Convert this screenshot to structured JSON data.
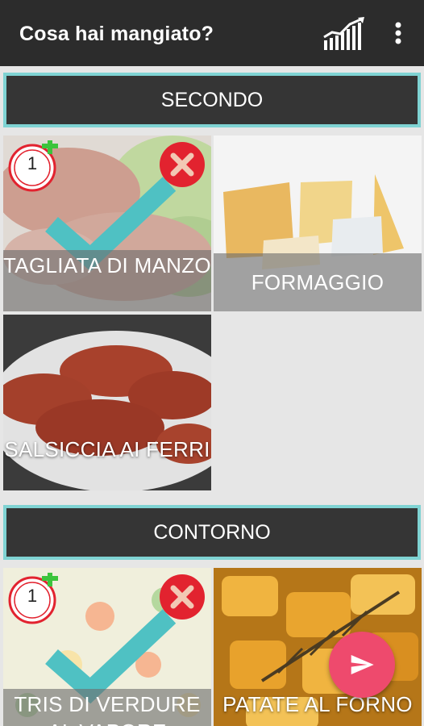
{
  "appbar": {
    "title": "Cosa hai mangiato?",
    "stats_icon": "bar-chart-trend-icon",
    "menu_icon": "more-vert-icon"
  },
  "sections": [
    {
      "title": "SECONDO",
      "items": [
        {
          "label": "TAGLIATA DI MANZO",
          "selected": true,
          "count": "1"
        },
        {
          "label": "FORMAGGIO",
          "selected": false
        },
        {
          "label": "SALSICCIA AI FERRI",
          "selected": false
        }
      ]
    },
    {
      "title": "CONTORNO",
      "items": [
        {
          "label": "TRIS DI VERDURE AL VAPORE",
          "selected": true,
          "count": "1"
        },
        {
          "label": "PATATE AL FORNO",
          "selected": false
        }
      ]
    }
  ],
  "fab": {
    "icon": "send-icon"
  },
  "colors": {
    "accent_teal": "#4fc1c3",
    "header_border": "#7fd3d3",
    "remove_red": "#e2232f",
    "fab_pink": "#ee4a6d",
    "plus_green": "#3cc43c"
  }
}
